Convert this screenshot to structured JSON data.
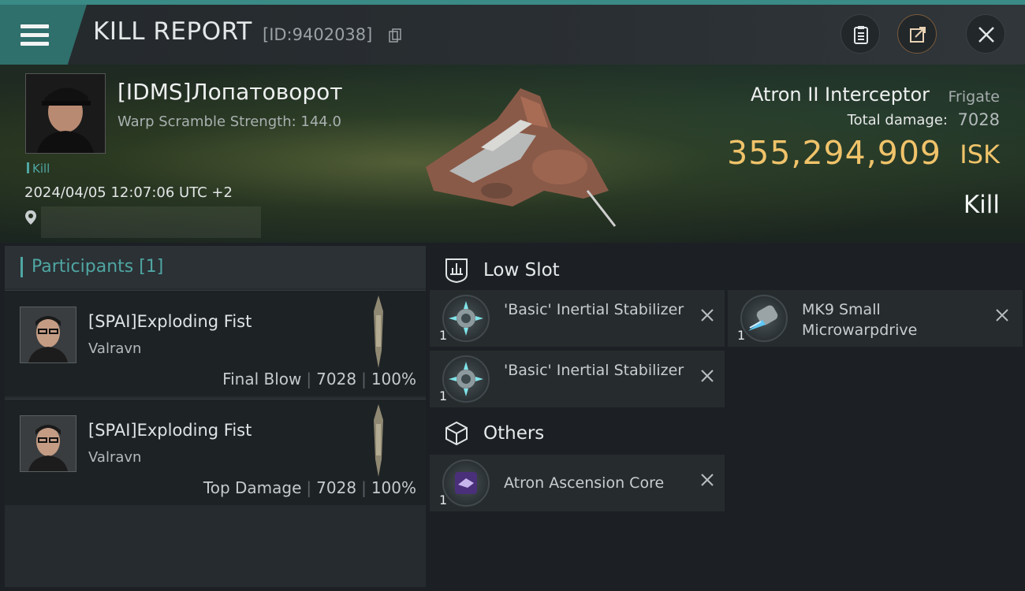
{
  "header": {
    "title": "KILL REPORT",
    "report_id": "[ID:9402038]",
    "icons": [
      "menu-icon",
      "copy-icon",
      "clipboard-icon",
      "share-icon",
      "close-icon"
    ]
  },
  "victim": {
    "name": "[IDMS]Лопатоворот",
    "scramble": "Warp Scramble Strength: 144.0",
    "tag": "Kill",
    "datetime": "2024/04/05 12:07:06 UTC +2"
  },
  "ship": {
    "name": "Atron II Interceptor",
    "class": "Frigate",
    "damage_label": "Total damage:",
    "damage_value": "7028",
    "isk_value": "355,294,909",
    "isk_unit": "ISK",
    "outcome": "Kill"
  },
  "participants": {
    "header": "Participants [1]",
    "list": [
      {
        "name": "[SPAI]Exploding Fist",
        "ship": "Valravn",
        "role": "Final Blow",
        "damage": "7028",
        "percent": "100%"
      },
      {
        "name": "[SPAI]Exploding Fist",
        "ship": "Valravn",
        "role": "Top Damage",
        "damage": "7028",
        "percent": "100%"
      }
    ]
  },
  "fittings": {
    "low_slot": {
      "label": "Low Slot",
      "items": [
        {
          "name": "'Basic' Inertial Stabilizer",
          "qty": "1"
        },
        {
          "name": "'Basic' Inertial Stabilizer",
          "qty": "1"
        },
        {
          "name": "MK9 Small Microwarpdrive",
          "qty": "1"
        }
      ]
    },
    "others": {
      "label": "Others",
      "items": [
        {
          "name": "Atron Ascension Core",
          "qty": "1"
        }
      ]
    }
  },
  "colors": {
    "accent": "#4fa6a3",
    "isk": "#f0c36a",
    "header_band": "#2f6f6c"
  }
}
